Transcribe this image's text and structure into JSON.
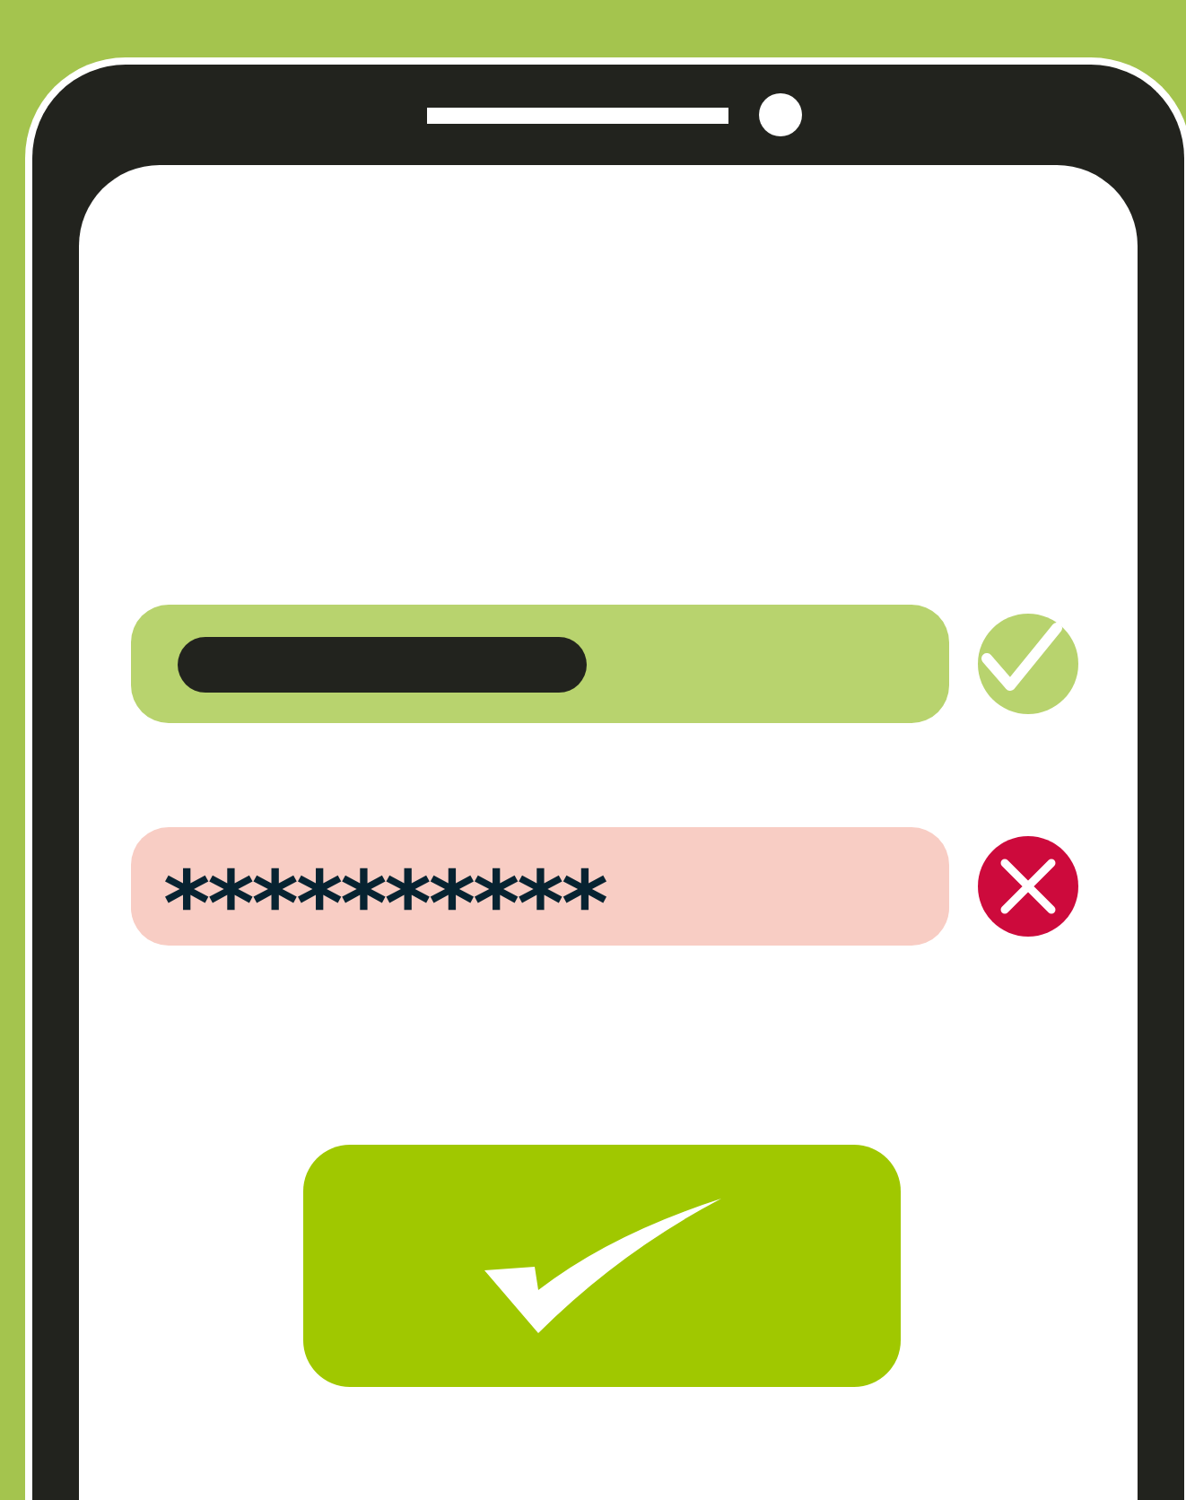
{
  "login_form": {
    "fields": [
      {
        "kind": "username",
        "valid": true
      },
      {
        "kind": "password",
        "value": "**********",
        "valid": false
      }
    ]
  }
}
